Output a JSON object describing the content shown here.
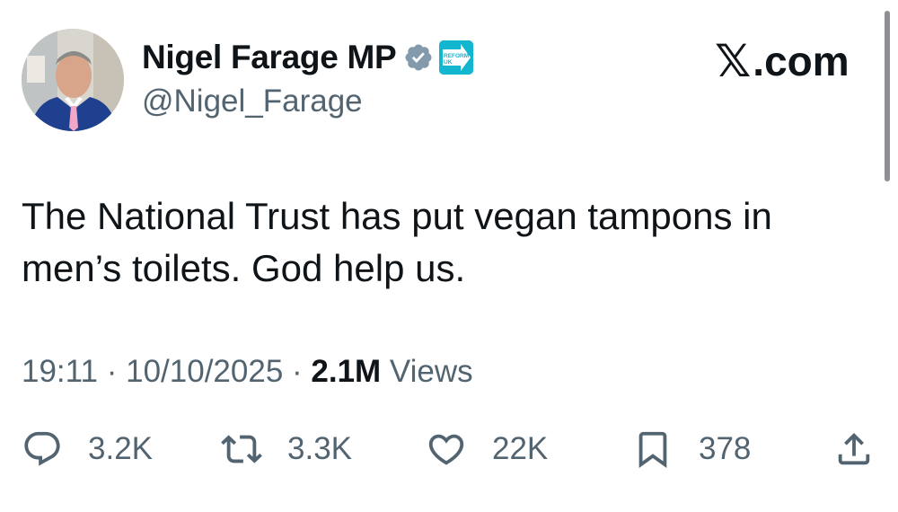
{
  "author": {
    "display_name": "Nigel Farage MP",
    "handle": "@Nigel_Farage",
    "affiliation_badge_text": [
      "REFORM",
      "UK"
    ]
  },
  "site": {
    "x": "𝕏",
    "suffix": ".com"
  },
  "tweet": {
    "line1": "The National Trust has put vegan tampons in",
    "line2": "men’s toilets. God help us."
  },
  "meta": {
    "time": "19:11",
    "sep1": " · ",
    "date": "10/10/2025",
    "sep2": " · ",
    "views_count": "2.1M",
    "views_label": " Views"
  },
  "actions": {
    "replies": "3.2K",
    "reposts": "3.3K",
    "likes": "22K",
    "bookmarks": "378"
  },
  "colors": {
    "text": "#0f1419",
    "secondary": "#536471",
    "verified_gray": "#829aab",
    "affiliation": "#12b6cf"
  }
}
